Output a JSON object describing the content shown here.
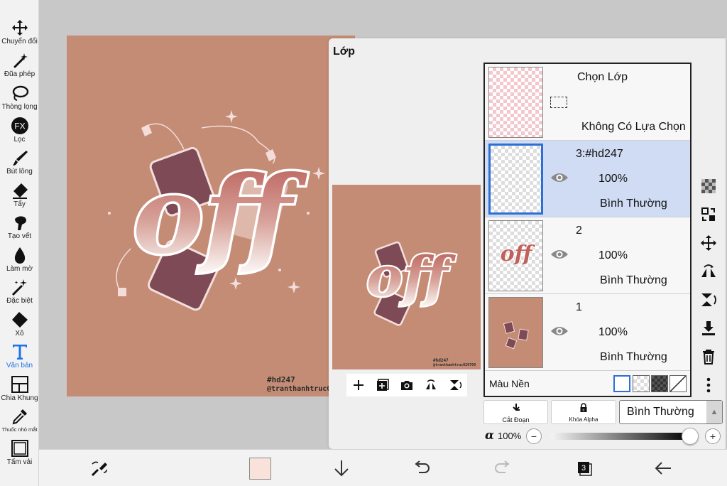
{
  "toolbar": {
    "tools": [
      {
        "label": "Chuyển đổi",
        "icon": "move-icon"
      },
      {
        "label": "Đũa phép",
        "icon": "magic-wand-icon"
      },
      {
        "label": "Thòng lọng",
        "icon": "lasso-icon"
      },
      {
        "label": "Lọc",
        "icon": "filter-fx-icon",
        "fx": "FX"
      },
      {
        "label": "Bút lông",
        "icon": "brush-icon"
      },
      {
        "label": "Tẩy",
        "icon": "eraser-icon"
      },
      {
        "label": "Tạo vết",
        "icon": "smudge-icon"
      },
      {
        "label": "Làm mờ",
        "icon": "blur-icon"
      },
      {
        "label": "Đặc biệt",
        "icon": "special-brush-icon"
      },
      {
        "label": "Xô",
        "icon": "bucket-icon"
      },
      {
        "label": "Văn bản",
        "icon": "text-icon",
        "active": true
      },
      {
        "label": "Chia Khung",
        "icon": "frame-divider-icon"
      },
      {
        "label": "Thuốc nhỏ mắt",
        "icon": "eyedropper-icon"
      },
      {
        "label": "Tấm vải",
        "icon": "canvas-icon"
      }
    ]
  },
  "canvas": {
    "background_color": "#c48c75",
    "artwork_text": "off",
    "signature_line1": "#hd247",
    "signature_line2": "@tranthanhtruc020709"
  },
  "layer_panel": {
    "title": "Lớp",
    "selection_row": {
      "label": "Chọn Lớp",
      "status": "Không Có Lựa Chọn"
    },
    "layers": [
      {
        "name": "3:#hd247",
        "opacity": "100%",
        "blend": "Bình Thường",
        "selected": true
      },
      {
        "name": "2",
        "opacity": "100%",
        "blend": "Bình Thường",
        "selected": false
      },
      {
        "name": "1",
        "opacity": "100%",
        "blend": "Bình Thường",
        "selected": false
      }
    ],
    "background_row": {
      "label": "Màu Nền"
    },
    "clipping_label": "Cắt Đoạn",
    "alpha_lock_label": "Khóa Alpha",
    "blend_mode": "Bình Thường",
    "alpha_symbol": "α",
    "alpha_value": "100%",
    "minus": "−",
    "plus": "+",
    "accent_color": "#2d6fd6",
    "selected_row_color": "#cfdcf3"
  },
  "bottom_bar": {
    "color_swatch": "#f8e2da",
    "layer_count": "3"
  }
}
